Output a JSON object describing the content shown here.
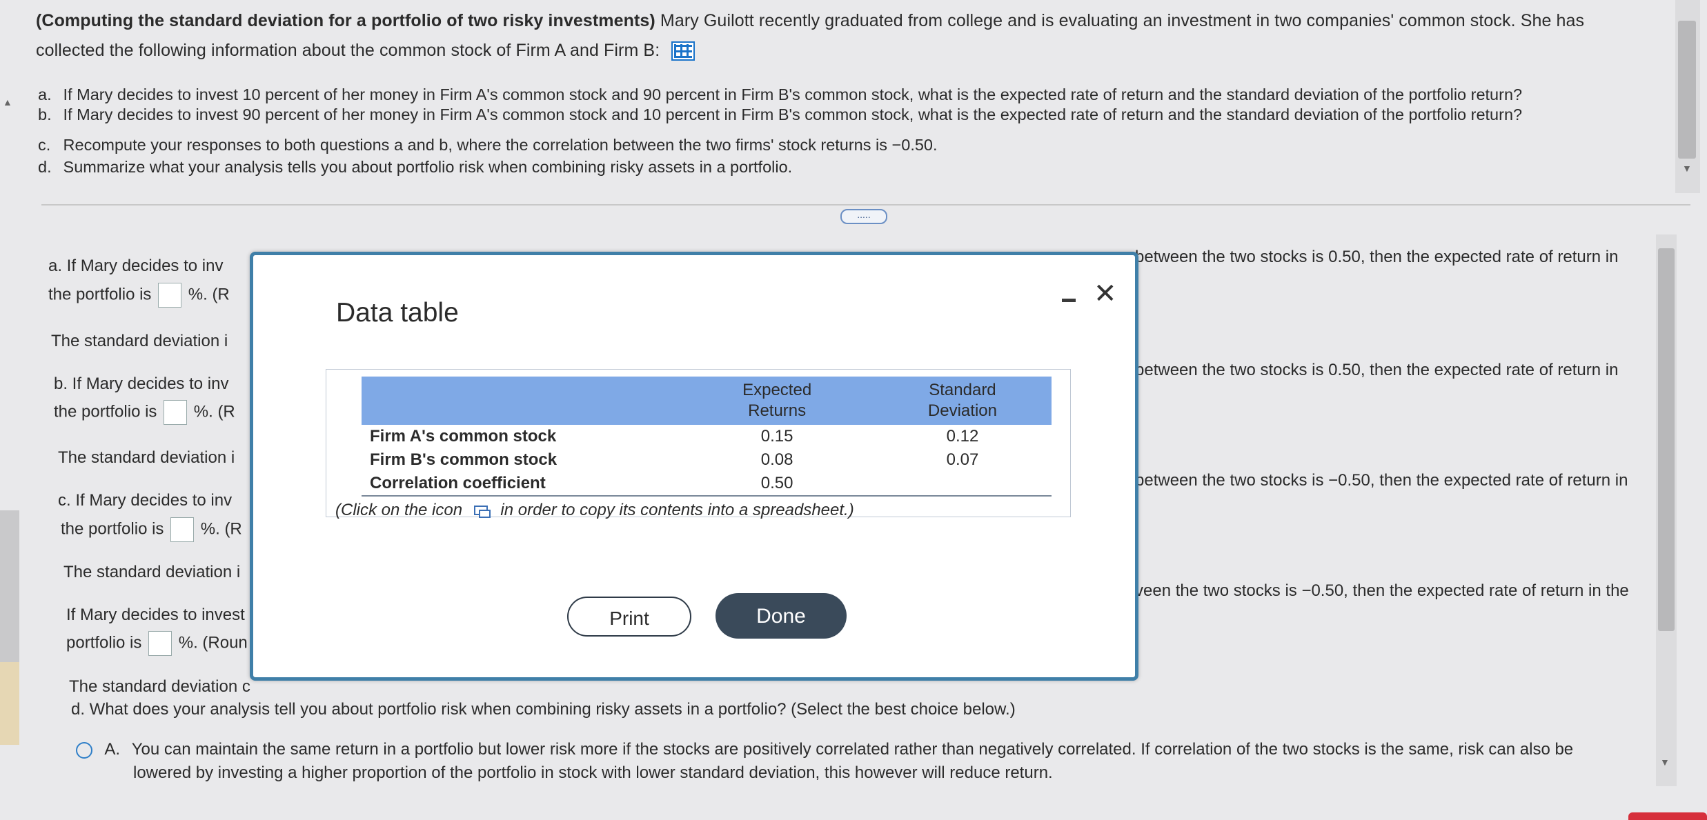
{
  "question": {
    "title": "(Computing the standard deviation for a portfolio of two risky investments)",
    "intro_1": "Mary Guilott recently graduated from college and is evaluating an investment in two companies' common stock. She has",
    "intro_2": "collected the following information about the common stock of Firm A and Firm B:",
    "parts": [
      {
        "label": "a.",
        "text": "If Mary decides to invest 10 percent of her money in Firm A's common stock and 90 percent in Firm B's common stock, what is the expected rate of return and the standard deviation of the portfolio return?"
      },
      {
        "label": "b.",
        "text": "If Mary decides to invest 90 percent of her money in Firm A's common stock and 10 percent in Firm B's common stock, what is the expected rate of return and the standard deviation of the portfolio return?"
      },
      {
        "label": "c.",
        "text": "Recompute your responses to both questions a and b, where the correlation between the two firms' stock returns is −0.50."
      },
      {
        "label": "d.",
        "text": "Summarize what your analysis tells you about portfolio risk when combining risky assets in a portfolio."
      }
    ],
    "expand_button": "....."
  },
  "answers": {
    "a_line1": "a.  If Mary decides to inv",
    "a_line2_pre": "the portfolio is",
    "a_line2_post": "%.  (R",
    "a_sd": "The standard deviation i",
    "b_line1": "b.  If Mary decides to inv",
    "b_line2_pre": "the portfolio is",
    "b_line2_post": "%.  (R",
    "b_sd": "The standard deviation i",
    "c_line1": "c.  If Mary decides to inv",
    "c_line2_pre": "the portfolio is",
    "c_line2_post": "%.  (R",
    "c_sd": "The standard deviation i",
    "c2_line1": "If Mary decides to invest",
    "c2_line2_pre": "portfolio is",
    "c2_line2_post": "%.  (Roun",
    "c2_sd": "The standard deviation c",
    "right_1": "between the two stocks is 0.50, then the expected rate of return in",
    "right_2": "between the two stocks is 0.50, then the expected rate of return in",
    "right_3": "between the two stocks is −0.50, then the expected rate of return in",
    "right_4": "veen the two stocks is −0.50, then the expected rate of return in the",
    "d_question": "d.  What does your analysis tell you about portfolio risk when combining risky assets in a portfolio?  (Select the best choice below.)",
    "option_a_label": "A.",
    "option_a_line1": "You can maintain the same return in a portfolio but lower risk more if the stocks are positively correlated rather than negatively correlated.  If correlation of the two stocks is the same, risk can also be",
    "option_a_line2": "lowered by investing a higher proportion of the portfolio in stock with lower standard deviation, this however will reduce return."
  },
  "modal": {
    "title": "Data table",
    "columns": [
      "",
      "Expected Returns",
      "Standard Deviation"
    ],
    "col1_h1": "Expected",
    "col1_h2": "Returns",
    "col2_h1": "Standard",
    "col2_h2": "Deviation",
    "rows": [
      {
        "label": "Firm A's common stock",
        "expected": "0.15",
        "sd": "0.12"
      },
      {
        "label": "Firm B's common stock",
        "expected": "0.08",
        "sd": "0.07"
      },
      {
        "label": "Correlation coefficient",
        "expected": "0.50",
        "sd": ""
      }
    ],
    "copy_note_pre": "(Click on the icon",
    "copy_note_post": "in order to copy its contents into a spreadsheet.)",
    "print_label": "Print",
    "done_label": "Done",
    "close_glyph": "✕"
  },
  "icons": {
    "grid": "spreadsheet-grid-icon",
    "copy": "copy-icon",
    "minimize": "minimize-icon",
    "close": "close-icon"
  },
  "colors": {
    "table_header": "#7fa9e6",
    "modal_border": "#3f7fa8",
    "done_button": "#3a4a5a",
    "radio": "#2f7fc8"
  }
}
